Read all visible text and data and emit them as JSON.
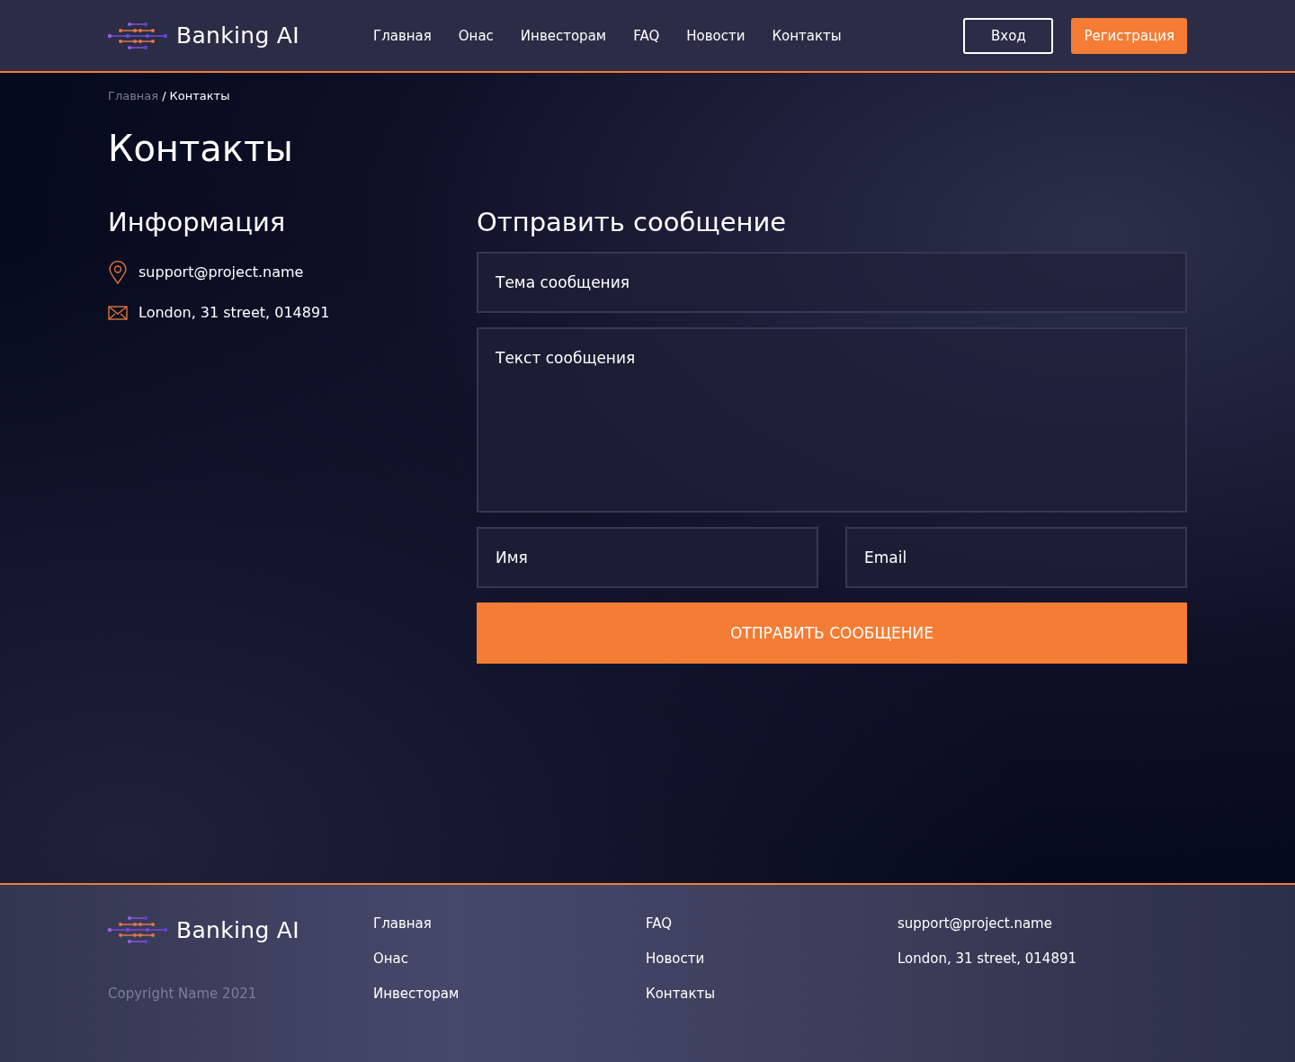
{
  "header": {
    "brand": "Banking AI",
    "nav": [
      "Главная",
      "Онас",
      "Инвесторам",
      "FAQ",
      "Новости",
      "Контакты"
    ],
    "login": "Вход",
    "register": "Регистрация"
  },
  "breadcrumb": {
    "items": [
      {
        "label": "Главная",
        "current": false
      },
      {
        "label": "Контакты",
        "current": true
      }
    ],
    "separator": "/"
  },
  "page_title": "Контакты",
  "info": {
    "title": "Информация",
    "items": [
      {
        "kind": "pin",
        "text": "support@project.name"
      },
      {
        "kind": "mail",
        "text": "London, 31 street, 014891"
      }
    ]
  },
  "form": {
    "title": "Отправить сообщение",
    "subject": {
      "placeholder": "Тема сообщения"
    },
    "message": {
      "placeholder": "Текст сообщения"
    },
    "name": {
      "placeholder": "Имя"
    },
    "email": {
      "placeholder": "Email"
    },
    "submit": "ОТПРАВИТЬ СООБЩЕНИЕ"
  },
  "footer": {
    "brand": "Banking AI",
    "copyright": "Copyright Name 2021",
    "columns": [
      [
        "Главная",
        "Онас",
        "Инвесторам"
      ],
      [
        "FAQ",
        "Новости",
        "Контакты"
      ],
      [
        "support@project.name",
        "London, 31 street, 014891"
      ]
    ]
  }
}
